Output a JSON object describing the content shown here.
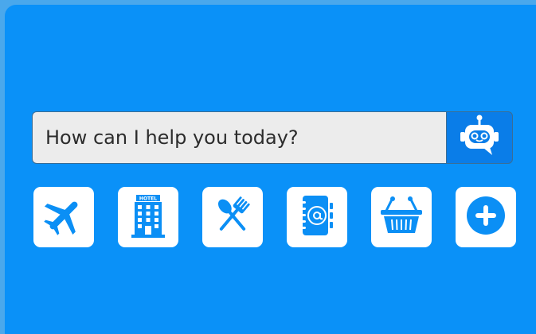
{
  "search": {
    "placeholder": "How can I help you today?"
  },
  "assistant_button": {
    "icon": "robot-chat-icon"
  },
  "shortcuts": [
    {
      "icon": "airplane-icon"
    },
    {
      "icon": "hotel-icon",
      "sign": "HOTEL"
    },
    {
      "icon": "fork-spoon-icon"
    },
    {
      "icon": "address-book-icon"
    },
    {
      "icon": "shopping-basket-icon"
    },
    {
      "icon": "plus-circle-icon"
    }
  ],
  "colors": {
    "panel": "#0a91f8",
    "icon": "#0b8ff5",
    "tile": "#ffffff",
    "input_bg": "#ececec"
  }
}
